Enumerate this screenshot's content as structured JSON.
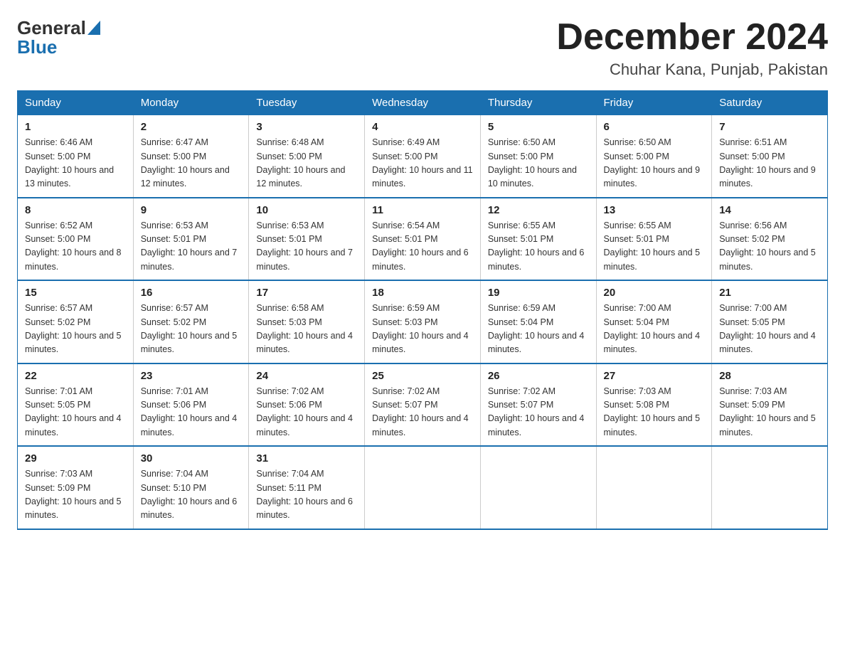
{
  "logo": {
    "part1": "General",
    "part2": "Blue"
  },
  "header": {
    "month": "December 2024",
    "location": "Chuhar Kana, Punjab, Pakistan"
  },
  "days_of_week": [
    "Sunday",
    "Monday",
    "Tuesday",
    "Wednesday",
    "Thursday",
    "Friday",
    "Saturday"
  ],
  "weeks": [
    [
      {
        "day": "1",
        "sunrise": "6:46 AM",
        "sunset": "5:00 PM",
        "daylight": "10 hours and 13 minutes."
      },
      {
        "day": "2",
        "sunrise": "6:47 AM",
        "sunset": "5:00 PM",
        "daylight": "10 hours and 12 minutes."
      },
      {
        "day": "3",
        "sunrise": "6:48 AM",
        "sunset": "5:00 PM",
        "daylight": "10 hours and 12 minutes."
      },
      {
        "day": "4",
        "sunrise": "6:49 AM",
        "sunset": "5:00 PM",
        "daylight": "10 hours and 11 minutes."
      },
      {
        "day": "5",
        "sunrise": "6:50 AM",
        "sunset": "5:00 PM",
        "daylight": "10 hours and 10 minutes."
      },
      {
        "day": "6",
        "sunrise": "6:50 AM",
        "sunset": "5:00 PM",
        "daylight": "10 hours and 9 minutes."
      },
      {
        "day": "7",
        "sunrise": "6:51 AM",
        "sunset": "5:00 PM",
        "daylight": "10 hours and 9 minutes."
      }
    ],
    [
      {
        "day": "8",
        "sunrise": "6:52 AM",
        "sunset": "5:00 PM",
        "daylight": "10 hours and 8 minutes."
      },
      {
        "day": "9",
        "sunrise": "6:53 AM",
        "sunset": "5:01 PM",
        "daylight": "10 hours and 7 minutes."
      },
      {
        "day": "10",
        "sunrise": "6:53 AM",
        "sunset": "5:01 PM",
        "daylight": "10 hours and 7 minutes."
      },
      {
        "day": "11",
        "sunrise": "6:54 AM",
        "sunset": "5:01 PM",
        "daylight": "10 hours and 6 minutes."
      },
      {
        "day": "12",
        "sunrise": "6:55 AM",
        "sunset": "5:01 PM",
        "daylight": "10 hours and 6 minutes."
      },
      {
        "day": "13",
        "sunrise": "6:55 AM",
        "sunset": "5:01 PM",
        "daylight": "10 hours and 5 minutes."
      },
      {
        "day": "14",
        "sunrise": "6:56 AM",
        "sunset": "5:02 PM",
        "daylight": "10 hours and 5 minutes."
      }
    ],
    [
      {
        "day": "15",
        "sunrise": "6:57 AM",
        "sunset": "5:02 PM",
        "daylight": "10 hours and 5 minutes."
      },
      {
        "day": "16",
        "sunrise": "6:57 AM",
        "sunset": "5:02 PM",
        "daylight": "10 hours and 5 minutes."
      },
      {
        "day": "17",
        "sunrise": "6:58 AM",
        "sunset": "5:03 PM",
        "daylight": "10 hours and 4 minutes."
      },
      {
        "day": "18",
        "sunrise": "6:59 AM",
        "sunset": "5:03 PM",
        "daylight": "10 hours and 4 minutes."
      },
      {
        "day": "19",
        "sunrise": "6:59 AM",
        "sunset": "5:04 PM",
        "daylight": "10 hours and 4 minutes."
      },
      {
        "day": "20",
        "sunrise": "7:00 AM",
        "sunset": "5:04 PM",
        "daylight": "10 hours and 4 minutes."
      },
      {
        "day": "21",
        "sunrise": "7:00 AM",
        "sunset": "5:05 PM",
        "daylight": "10 hours and 4 minutes."
      }
    ],
    [
      {
        "day": "22",
        "sunrise": "7:01 AM",
        "sunset": "5:05 PM",
        "daylight": "10 hours and 4 minutes."
      },
      {
        "day": "23",
        "sunrise": "7:01 AM",
        "sunset": "5:06 PM",
        "daylight": "10 hours and 4 minutes."
      },
      {
        "day": "24",
        "sunrise": "7:02 AM",
        "sunset": "5:06 PM",
        "daylight": "10 hours and 4 minutes."
      },
      {
        "day": "25",
        "sunrise": "7:02 AM",
        "sunset": "5:07 PM",
        "daylight": "10 hours and 4 minutes."
      },
      {
        "day": "26",
        "sunrise": "7:02 AM",
        "sunset": "5:07 PM",
        "daylight": "10 hours and 4 minutes."
      },
      {
        "day": "27",
        "sunrise": "7:03 AM",
        "sunset": "5:08 PM",
        "daylight": "10 hours and 5 minutes."
      },
      {
        "day": "28",
        "sunrise": "7:03 AM",
        "sunset": "5:09 PM",
        "daylight": "10 hours and 5 minutes."
      }
    ],
    [
      {
        "day": "29",
        "sunrise": "7:03 AM",
        "sunset": "5:09 PM",
        "daylight": "10 hours and 5 minutes."
      },
      {
        "day": "30",
        "sunrise": "7:04 AM",
        "sunset": "5:10 PM",
        "daylight": "10 hours and 6 minutes."
      },
      {
        "day": "31",
        "sunrise": "7:04 AM",
        "sunset": "5:11 PM",
        "daylight": "10 hours and 6 minutes."
      },
      null,
      null,
      null,
      null
    ]
  ]
}
